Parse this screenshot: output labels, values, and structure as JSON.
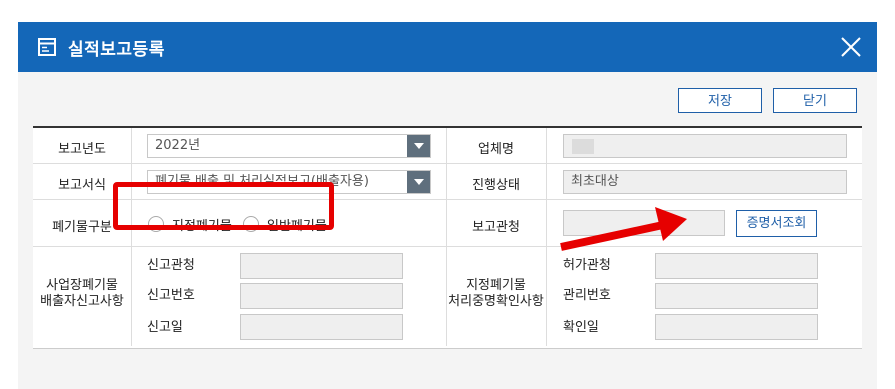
{
  "dialog": {
    "title": "실적보고등록",
    "close_icon": "close-icon",
    "title_icon": "form-window-icon"
  },
  "toolbar": {
    "save_label": "저장",
    "close_label": "닫기"
  },
  "form": {
    "report_year_label": "보고년도",
    "report_year_value": "2022년",
    "company_name_label": "업체명",
    "report_format_label": "보고서식",
    "report_format_value": "폐기물 배출 및 처리실적보고(배출자용)",
    "progress_label": "진행상태",
    "progress_value": "최초대상",
    "waste_type_label": "폐기물구분",
    "waste_type_options": [
      "지정폐기물",
      "일반폐기물"
    ],
    "report_office_label": "보고관청",
    "certificate_button": "증명서조회",
    "business_waste_label_1": "사업장폐기물",
    "business_waste_label_2": "배출자신고사항",
    "designated_waste_label_1": "지정폐기물",
    "designated_waste_label_2": "처리중명확인사항",
    "report_office_sub": "신고관청",
    "report_number_sub": "신고번호",
    "report_date_sub": "신고일",
    "permit_office_sub": "허가관청",
    "manage_number_sub": "관리번호",
    "confirm_date_sub": "확인일"
  },
  "colors": {
    "title_bar": "#1467b8",
    "annotation": "#e60000",
    "button_border": "#1f5fa8"
  }
}
